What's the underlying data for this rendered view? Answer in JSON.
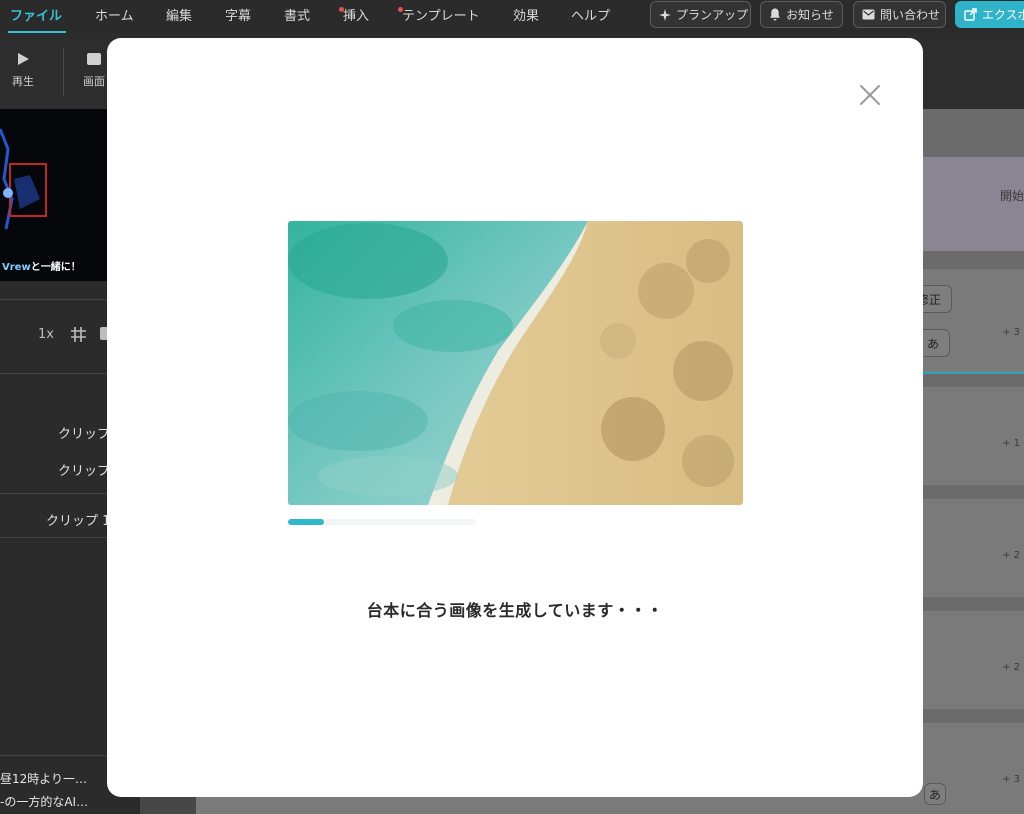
{
  "menu": {
    "items": [
      {
        "label": "ファイル",
        "active": true,
        "dot": false
      },
      {
        "label": "ホーム",
        "active": false,
        "dot": false
      },
      {
        "label": "編集",
        "active": false,
        "dot": false
      },
      {
        "label": "字幕",
        "active": false,
        "dot": false
      },
      {
        "label": "書式",
        "active": false,
        "dot": false
      },
      {
        "label": "挿入",
        "active": false,
        "dot": true
      },
      {
        "label": "テンプレート",
        "active": false,
        "dot": true
      },
      {
        "label": "効果",
        "active": false,
        "dot": false
      },
      {
        "label": "ヘルプ",
        "active": false,
        "dot": false
      }
    ],
    "plan_up": "プランアップ",
    "notice": "お知らせ",
    "contact": "問い合わせ",
    "export": "エクスポ"
  },
  "toolbar": {
    "play": "再生",
    "screen": "画面"
  },
  "left_panel": {
    "video_caption_brand": "Vrew",
    "video_caption_rest": "と一緒に！",
    "speed": "1x",
    "clip_rows": [
      "クリップ",
      "クリップ",
      "クリップ 1"
    ],
    "bottom_line1": "昼12時より一…",
    "bottom_line2": "-の一方的なAI…"
  },
  "right_area": {
    "start_label": "開始",
    "fix_label": "修正",
    "hiragana_a": "あ",
    "row_nums": [
      "+ 3",
      "+ 1",
      "+ 2",
      "+ 2",
      "+ 3"
    ]
  },
  "modal": {
    "status_text": "台本に合う画像を生成しています・・・",
    "progress": 0.19,
    "colors": {
      "accent": "#2fb8cc",
      "sea": "#3fb8a8",
      "sand": "#e2c98e"
    }
  }
}
